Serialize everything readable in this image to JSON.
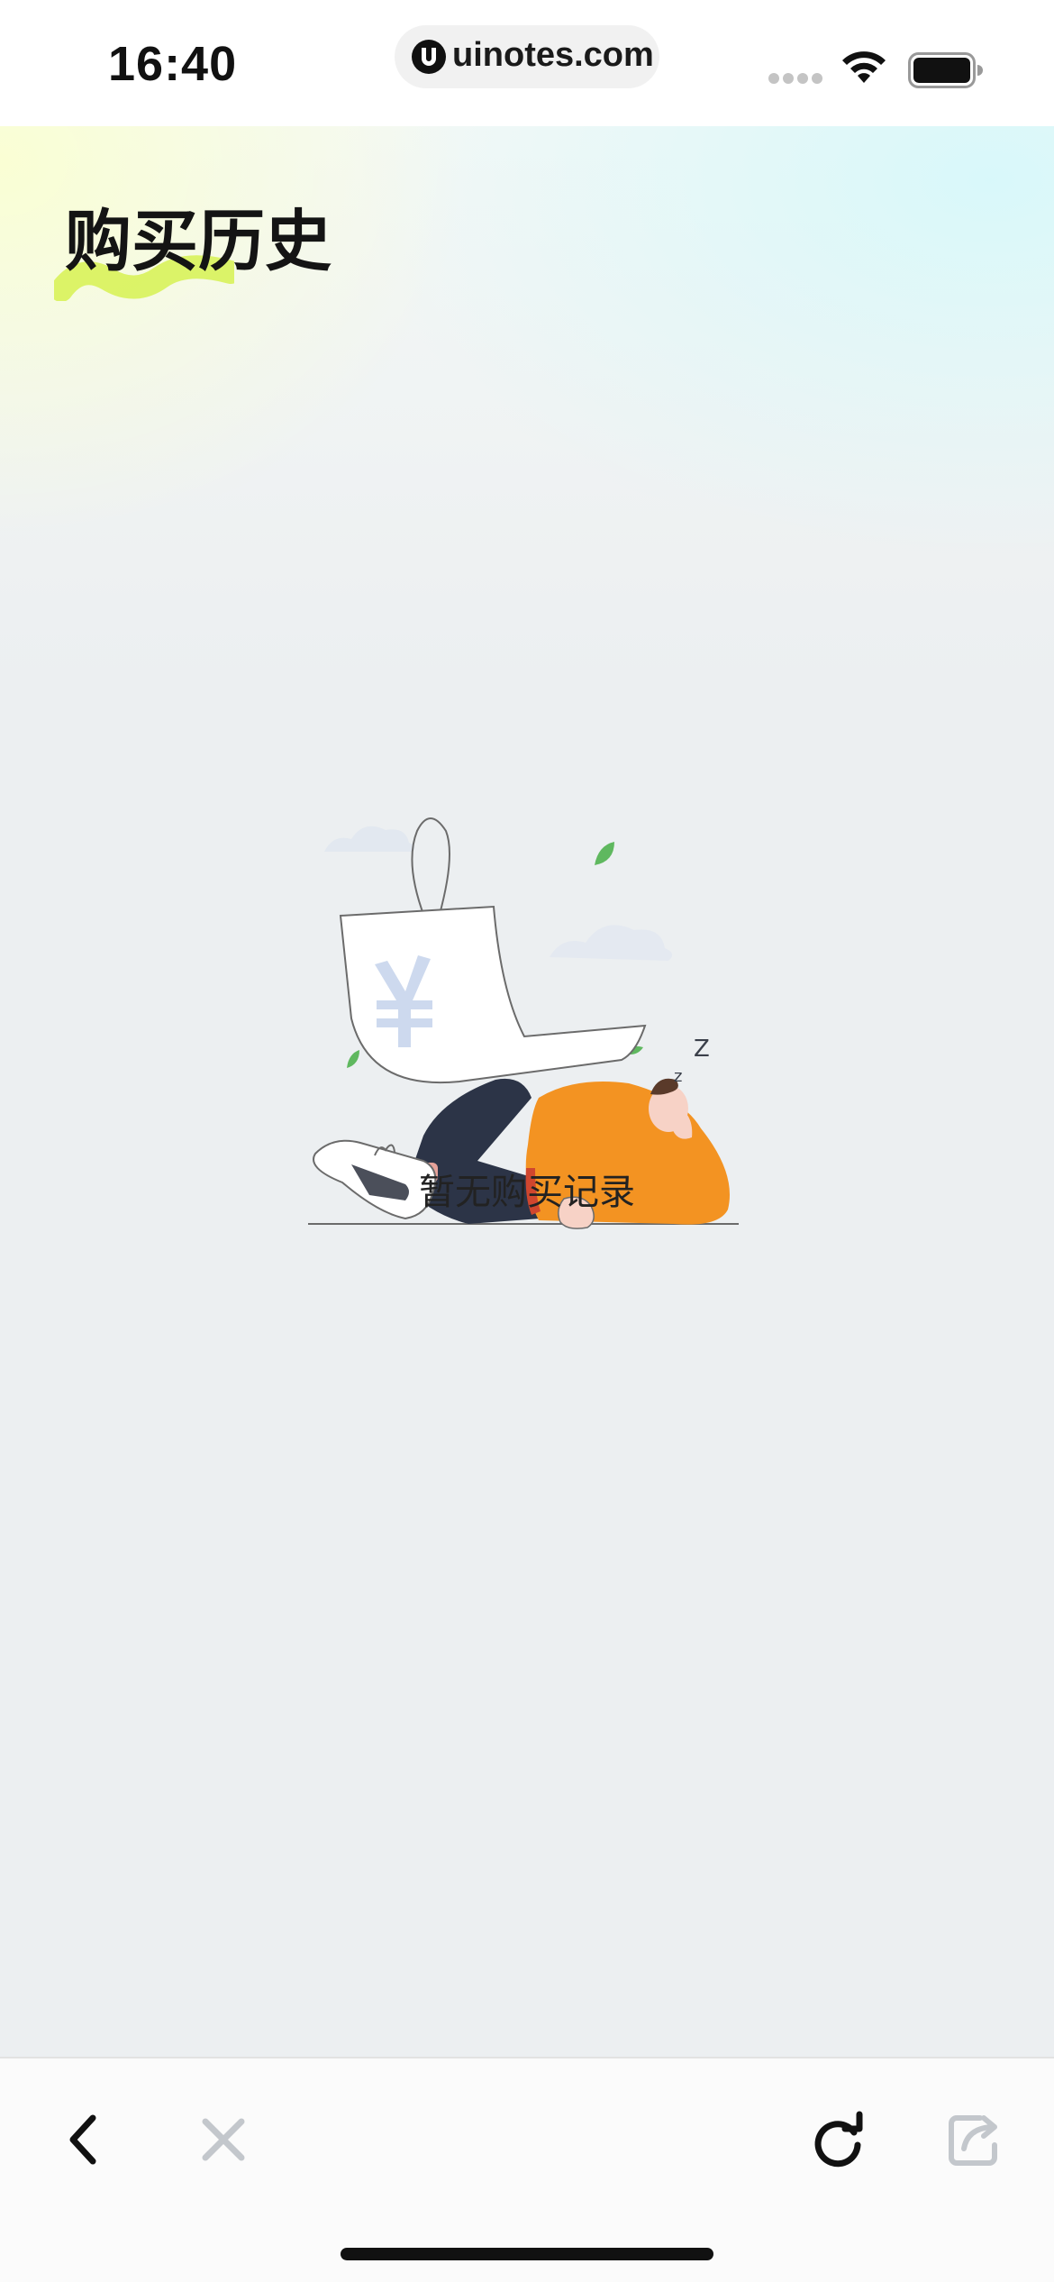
{
  "status_bar": {
    "time": "16:40",
    "url": "uinotes.com",
    "icons": [
      "signal-icon",
      "wifi-icon",
      "battery-icon"
    ]
  },
  "page": {
    "title": "购买历史",
    "empty_message": "暂无购买记录"
  },
  "toolbar": {
    "buttons": [
      "back-icon",
      "close-icon",
      "reload-icon",
      "share-icon"
    ]
  },
  "colors": {
    "title_highlight": "#d8f25a",
    "accent_orange": "#f39322",
    "leaf_green": "#5fb85f"
  }
}
